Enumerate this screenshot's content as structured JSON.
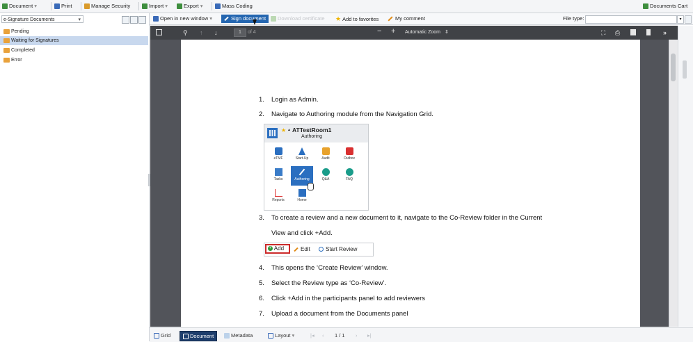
{
  "topbar": {
    "document": "Document",
    "print": "Print",
    "manage_security": "Manage Security",
    "import": "Import",
    "export": "Export",
    "mass_coding": "Mass Coding",
    "documents_cart": "Documents Cart"
  },
  "left_panel": {
    "select_value": "e-Signature Documents",
    "items": [
      {
        "label": "Pending"
      },
      {
        "label": "Waiting for Signatures"
      },
      {
        "label": "Completed"
      },
      {
        "label": "Error"
      }
    ]
  },
  "toolbar2": {
    "open_new_window": "Open in new window",
    "sign_document": "Sign document",
    "download_certificate": "Download certificate",
    "add_to_favorites": "Add to favorites",
    "my_comment": "My comment",
    "file_type_label": "File type:",
    "file_type_value": ""
  },
  "pdf_toolbar": {
    "page_number": "1",
    "page_total": "of 4",
    "minus": "−",
    "plus": "+",
    "zoom": "Automatic Zoom"
  },
  "document": {
    "steps": [
      {
        "num": "1.",
        "text": "Login as Admin."
      },
      {
        "num": "2.",
        "text": "Navigate to Authoring module from the Navigation Grid."
      },
      {
        "num": "3.",
        "text": "To create a review and a new document to it, navigate to the Co-Review folder in the Current"
      },
      {
        "num": "",
        "text": "View and click +Add."
      },
      {
        "num": "4.",
        "text": "This opens the ‘Create Review’ window."
      },
      {
        "num": "5.",
        "text": "Select the Review type as ‘Co-Review’."
      },
      {
        "num": "6.",
        "text": "Click +Add  in the participants panel to add reviewers"
      },
      {
        "num": "7.",
        "text": "Upload a document from the Documents panel"
      }
    ],
    "inset": {
      "room_title": "ATTestRoom1",
      "room_subtitle": "Authoring",
      "modules": [
        {
          "label": "eTMF"
        },
        {
          "label": "Start-Up"
        },
        {
          "label": "Audit"
        },
        {
          "label": "Outbox"
        },
        {
          "label": "Tasks"
        },
        {
          "label": "Authoring"
        },
        {
          "label": "Q&A"
        },
        {
          "label": "FAQ"
        },
        {
          "label": "Reports"
        },
        {
          "label": "Home"
        }
      ]
    },
    "review_bar": {
      "add": "Add",
      "edit": "Edit",
      "start_review": "Start Review"
    }
  },
  "bottombar": {
    "grid": "Grid",
    "document": "Document",
    "metadata": "Metadata",
    "layout": "Layout",
    "pager": "1 / 1"
  },
  "colors": {
    "accent": "#2466b0",
    "folder": "#e9a23b",
    "pdf_toolbar": "#404246",
    "viewer_bg": "#52545a",
    "highlight": "#cc2b2b"
  }
}
